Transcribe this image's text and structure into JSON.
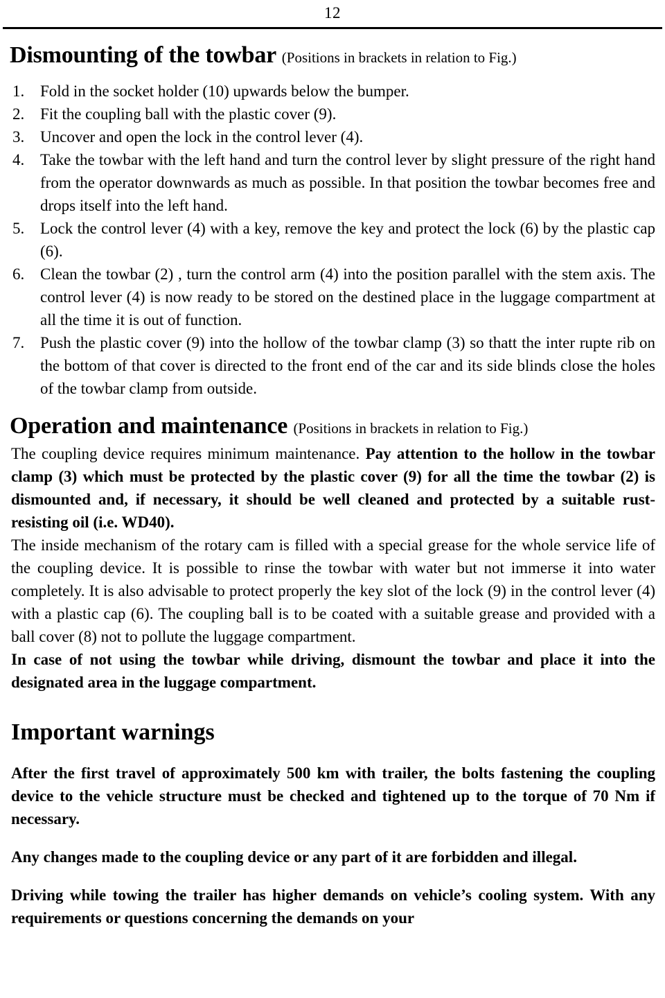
{
  "page": {
    "number": "12"
  },
  "sections": {
    "dismounting": {
      "heading": "Dismounting of the towbar",
      "heading_note": "(Positions in brackets in relation to Fig.)",
      "steps": [
        {
          "num": "1.",
          "text": "Fold in the socket holder (10) upwards below the bumper."
        },
        {
          "num": "2.",
          "text": "Fit the coupling ball  with the plastic cover (9)."
        },
        {
          "num": "3.",
          "text": "Uncover and open the lock in the control lever (4)."
        },
        {
          "num": "4.",
          "text": "Take the towbar with the left hand and turn the control lever by slight pressure of the right hand from the operator downwards as much as possible. In that position the towbar becomes free and drops itself into the left hand."
        },
        {
          "num": "5.",
          "text": "Lock the control lever (4) with a key, remove the key and protect the lock (6) by the plastic cap (6)."
        },
        {
          "num": "6.",
          "text": "Clean the towbar (2) , turn the control arm (4) into the position parallel with the stem axis. The control lever (4) is now ready to be stored on the destined place in the luggage compartment at all the time it is out of function."
        },
        {
          "num": "7.",
          "text": "Push the plastic cover (9) into the hollow of the towbar clamp (3) so thatt the inter rupte rib on the bottom of that cover is directed to the front end of the car and its side blinds close the holes of the towbar clamp from outside."
        }
      ]
    },
    "operation": {
      "heading": "Operation and maintenance",
      "heading_note": "(Positions in brackets in relation to Fig.)",
      "paragraph1_regular": "The coupling device requires minimum maintenance. ",
      "paragraph1_bold": "Pay attention to the hollow in the towbar clamp (3) which must be protected by the plastic cover (9) for all the time the towbar (2) is dismounted and, if necessary, it should be well cleaned and protected by a suitable rust-resisting oil (i.e. WD40).",
      "paragraph2": "The inside mechanism of the rotary cam is filled with a special grease for the whole service life of the coupling device. It is possible to rinse the towbar with water but not immerse it into water completely. It is also advisable to protect properly the key slot of the lock (9) in the control lever (4) with a plastic cap (6). The coupling ball is to be coated with a suitable grease and provided with a ball cover (8)  not to pollute the luggage compartment.",
      "paragraph3_bold": "In case of not using the towbar while driving, dismount the towbar and place it into the designated area in the luggage compartment."
    },
    "warnings": {
      "heading": "Important warnings",
      "paragraph1": "After the first travel of approximately 500 km with trailer, the bolts fastening the coupling device to the vehicle structure must be checked and tightened up to the torque of 70 Nm if necessary.",
      "paragraph2": "Any changes made to the coupling device or any part of it are forbidden and illegal.",
      "paragraph3": "Driving while towing the trailer has higher demands on vehicle’s cooling system. With any requirements or questions concerning the demands on your"
    }
  }
}
